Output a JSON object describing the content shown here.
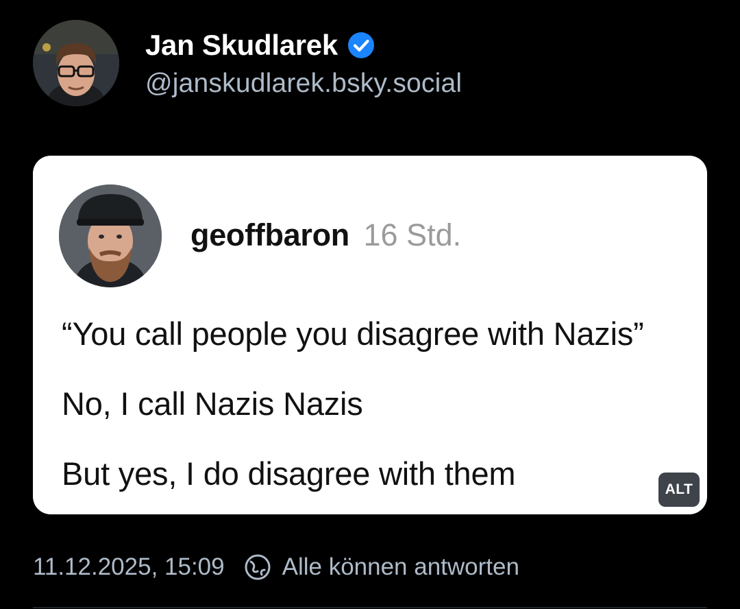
{
  "post": {
    "author": {
      "name": "Jan Skudlarek",
      "handle": "@janskudlarek.bsky.social",
      "verified": true,
      "verified_color": "#1a85ff"
    },
    "embed": {
      "quoted_username": "geoffbaron",
      "quoted_time": "16 Std.",
      "lines": [
        "“You call people you disagree with Nazis”",
        "No, I call Nazis Nazis",
        "But yes, I do disagree with them"
      ],
      "alt_label": "ALT"
    },
    "footer": {
      "timestamp": "11.12.2025, 15:09",
      "reply_setting_icon": "globe-icon",
      "reply_setting": "Alle können antworten"
    }
  },
  "colors": {
    "background": "#000000",
    "text_primary": "#ffffff",
    "text_secondary": "#aebbc9",
    "card_background": "#ffffff"
  }
}
